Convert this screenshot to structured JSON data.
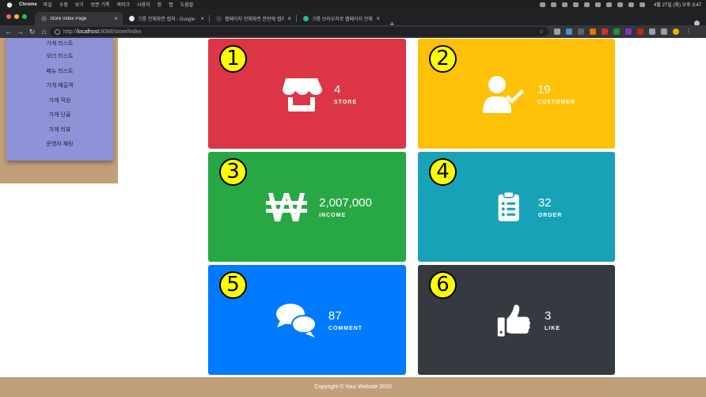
{
  "menubar": {
    "app": "Chrome",
    "items": [
      "파일",
      "수정",
      "보기",
      "방문 기록",
      "북마크",
      "사용자",
      "창",
      "탭",
      "도움말"
    ],
    "clock": "4월 27일 (화) 오후 3:47"
  },
  "tabs": [
    {
      "title": "Store Index Page",
      "close": "×"
    },
    {
      "title": "크롬 전체화면 캡쳐 - Google 검색",
      "close": "×"
    },
    {
      "title": "웹페이지 전체화면 한번에 캡처하기 (…",
      "close": "×"
    },
    {
      "title": "크롬 브라우저로 웹페이지 전체를 한…",
      "close": "×"
    }
  ],
  "new_tab": "+",
  "address": {
    "host": "localhost",
    "rest": ":8088/store/index",
    "prefix": "http://"
  },
  "sidebar": {
    "items": [
      {
        "label": "가게 리스트"
      },
      {
        "label": "오더 리스트"
      },
      {
        "label": "메뉴 리스트"
      },
      {
        "label": "가게 매출액"
      },
      {
        "label": "가게 직원"
      },
      {
        "label": "가게 단골"
      },
      {
        "label": "가게 리뷰"
      },
      {
        "label": "운영자 채팅"
      }
    ]
  },
  "cards": [
    {
      "badge": "1",
      "value": "4",
      "label": "STORE",
      "icon": "store-icon",
      "color": "#dc3545"
    },
    {
      "badge": "2",
      "value": "19",
      "label": "CUSTOMER",
      "icon": "user-check-icon",
      "color": "#ffc107"
    },
    {
      "badge": "3",
      "value": "2,007,000",
      "label": "INCOME",
      "icon": "won-sign-icon",
      "color": "#28a745"
    },
    {
      "badge": "4",
      "value": "32",
      "label": "ORDER",
      "icon": "clipboard-list-icon",
      "color": "#17a2b8"
    },
    {
      "badge": "5",
      "value": "87",
      "label": "COMMENT",
      "icon": "comments-icon",
      "color": "#007bff"
    },
    {
      "badge": "6",
      "value": "3",
      "label": "LIKE",
      "icon": "thumbs-up-icon",
      "color": "#343a40"
    }
  ],
  "footer": {
    "text": "Copyright © Your Website 2020"
  }
}
